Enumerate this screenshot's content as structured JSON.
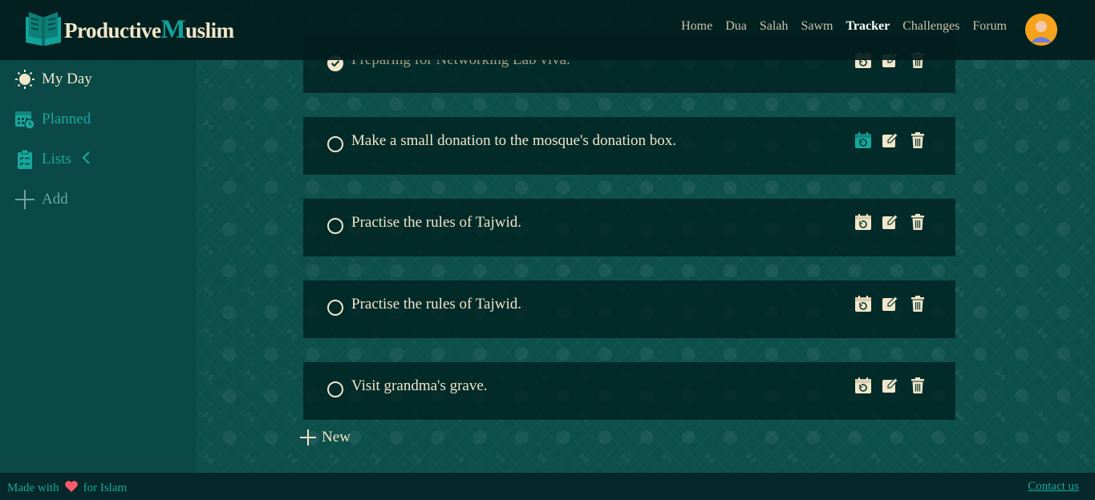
{
  "brand": {
    "logo_part1": "Productive",
    "logo_part2": "M",
    "logo_part3": "uslim"
  },
  "nav": {
    "items": [
      {
        "label": "Home"
      },
      {
        "label": "Dua"
      },
      {
        "label": "Salah"
      },
      {
        "label": "Sawm"
      },
      {
        "label": "Tracker",
        "active": true
      },
      {
        "label": "Challenges"
      },
      {
        "label": "Forum"
      }
    ]
  },
  "sidebar": {
    "items": [
      {
        "label": "My Day",
        "icon": "sun-icon"
      },
      {
        "label": "Planned",
        "icon": "calendar-clock-icon"
      },
      {
        "label": "Lists",
        "icon": "clipboard-list-icon"
      },
      {
        "label": "Add",
        "icon": "plus-icon"
      }
    ]
  },
  "tasks": [
    {
      "title": "Preparing for Networking Lab viva.",
      "done": true
    },
    {
      "title": "Make a small donation to the mosque's donation box.",
      "done": false
    },
    {
      "title": "Practise the rules of Tajwid.",
      "done": false
    },
    {
      "title": "Practise the rules of Tajwid.",
      "done": false
    },
    {
      "title": "Visit grandma's grave.",
      "done": false
    }
  ],
  "new_label": "New",
  "footer": {
    "made_prefix": "Made with",
    "made_suffix": "for Islam",
    "contact": "Contact us"
  },
  "colors": {
    "accent": "#18a79d",
    "cream": "#f1e6c8",
    "header": "#021c1c",
    "heart": "#ff5a6b",
    "avatar": "#f6a21c"
  }
}
